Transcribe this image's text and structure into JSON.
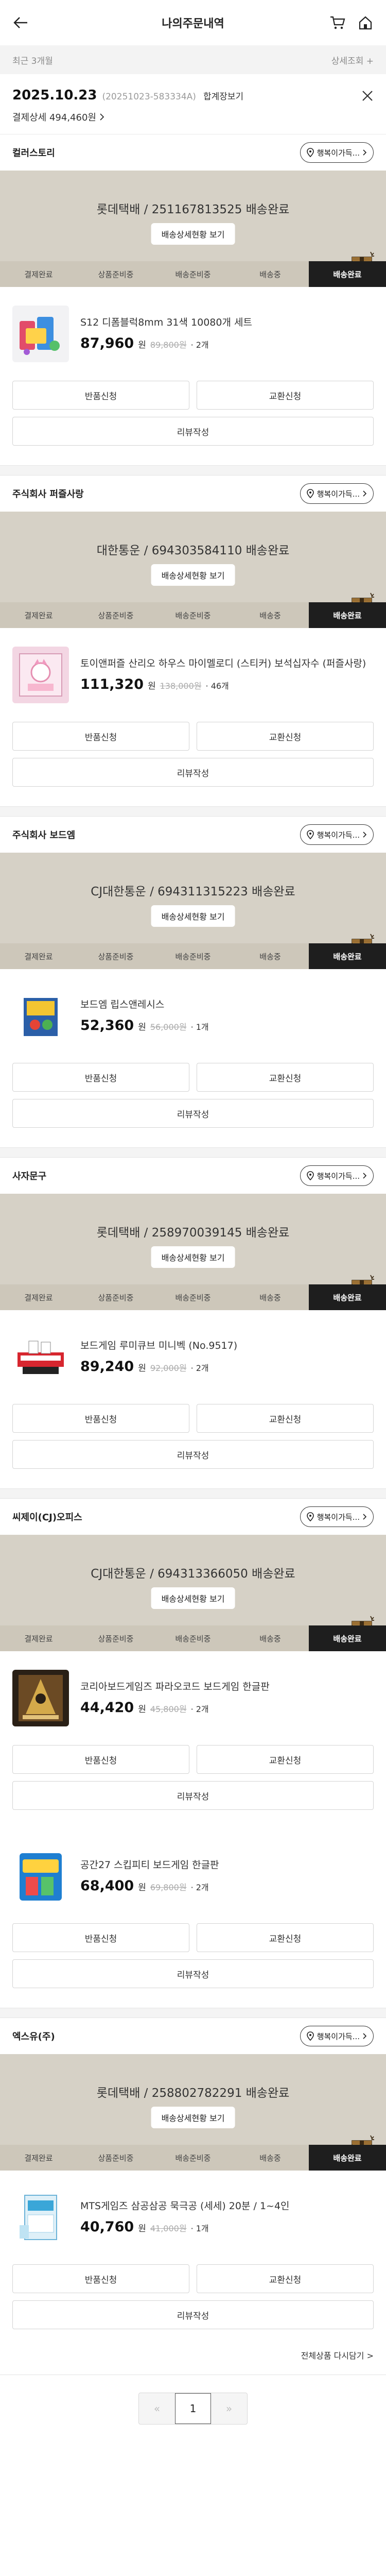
{
  "header": {
    "title": "나의주문내역"
  },
  "filter": {
    "period": "최근 3개월",
    "detail": "상세조회 +"
  },
  "order": {
    "date": "2025.10.23",
    "number": "(20251023-583334A)",
    "merge_label": "합계장보기",
    "payment": "결제상세 494,460원"
  },
  "common": {
    "happy_label": "행복이가득...",
    "detail_button": "배송상세현황 보기",
    "steps": [
      "결제완료",
      "상품준비중",
      "배송준비중",
      "배송중",
      "배송완료"
    ],
    "return_label": "반품신청",
    "exchange_label": "교환신청",
    "review_label": "리뷰작성",
    "currency_unit": "원"
  },
  "groups": [
    {
      "seller": "컬러스토리",
      "courier": "롯데택배 / 251167813525 배송완료",
      "products": [
        {
          "name": "S12 디폼블럭8mm 31색 10080개 세트",
          "price": "87,960",
          "original": "89,800원",
          "qty": "· 2개",
          "thumb": "beads"
        }
      ]
    },
    {
      "seller": "주식회사 퍼즐사랑",
      "courier": "대한통운 / 694303584110 배송완료",
      "products": [
        {
          "name": "토이앤퍼즐 산리오 하우스 마이멜로디 (스티커) 보석십자수 (퍼즐사랑)",
          "price": "111,320",
          "original": "138,000원",
          "qty": "· 46개",
          "thumb": "gem"
        }
      ]
    },
    {
      "seller": "주식회사 보드엠",
      "courier": "CJ대한통운 / 694311315223 배송완료",
      "products": [
        {
          "name": "보드엠 립스앤레시스",
          "price": "52,360",
          "original": "56,000원",
          "qty": "· 1개",
          "thumb": "board"
        }
      ]
    },
    {
      "seller": "사자문구",
      "courier": "롯데택배 / 258970039145 배송완료",
      "products": [
        {
          "name": "보드게임 루미큐브 미니벡 (No.9517)",
          "price": "89,240",
          "original": "92,000원",
          "qty": "· 2개",
          "thumb": "rummy"
        }
      ]
    },
    {
      "seller": "씨제이(CJ)오피스",
      "courier": "CJ대한통운 / 694313366050 배송완료",
      "products": [
        {
          "name": "코리아보드게임즈 파라오코드 보드게임 한글판",
          "price": "44,420",
          "original": "45,800원",
          "qty": "· 2개",
          "thumb": "pharaoh"
        },
        {
          "name": "공간27 스킵피티 보드게임 한글판",
          "price": "68,400",
          "original": "69,800원",
          "qty": "· 2개",
          "thumb": "skip"
        }
      ]
    },
    {
      "seller": "엑스유(주)",
      "courier": "롯데택배 / 258802782291 배송완료",
      "products": [
        {
          "name": "MTS게임즈 삼공삼공 묵극공 (세세) 20분 / 1~4인",
          "price": "40,760",
          "original": "41,000원",
          "qty": "· 1개",
          "thumb": "mts"
        }
      ]
    }
  ],
  "reorder_label": "전체상품 다시담기 >",
  "pagination": {
    "prev": "«",
    "current": "1",
    "next": "»"
  },
  "colors": {
    "banner": "#d6d1c6",
    "steps_bg": "#cdc7ba",
    "active_step": "#1e1e1e"
  }
}
